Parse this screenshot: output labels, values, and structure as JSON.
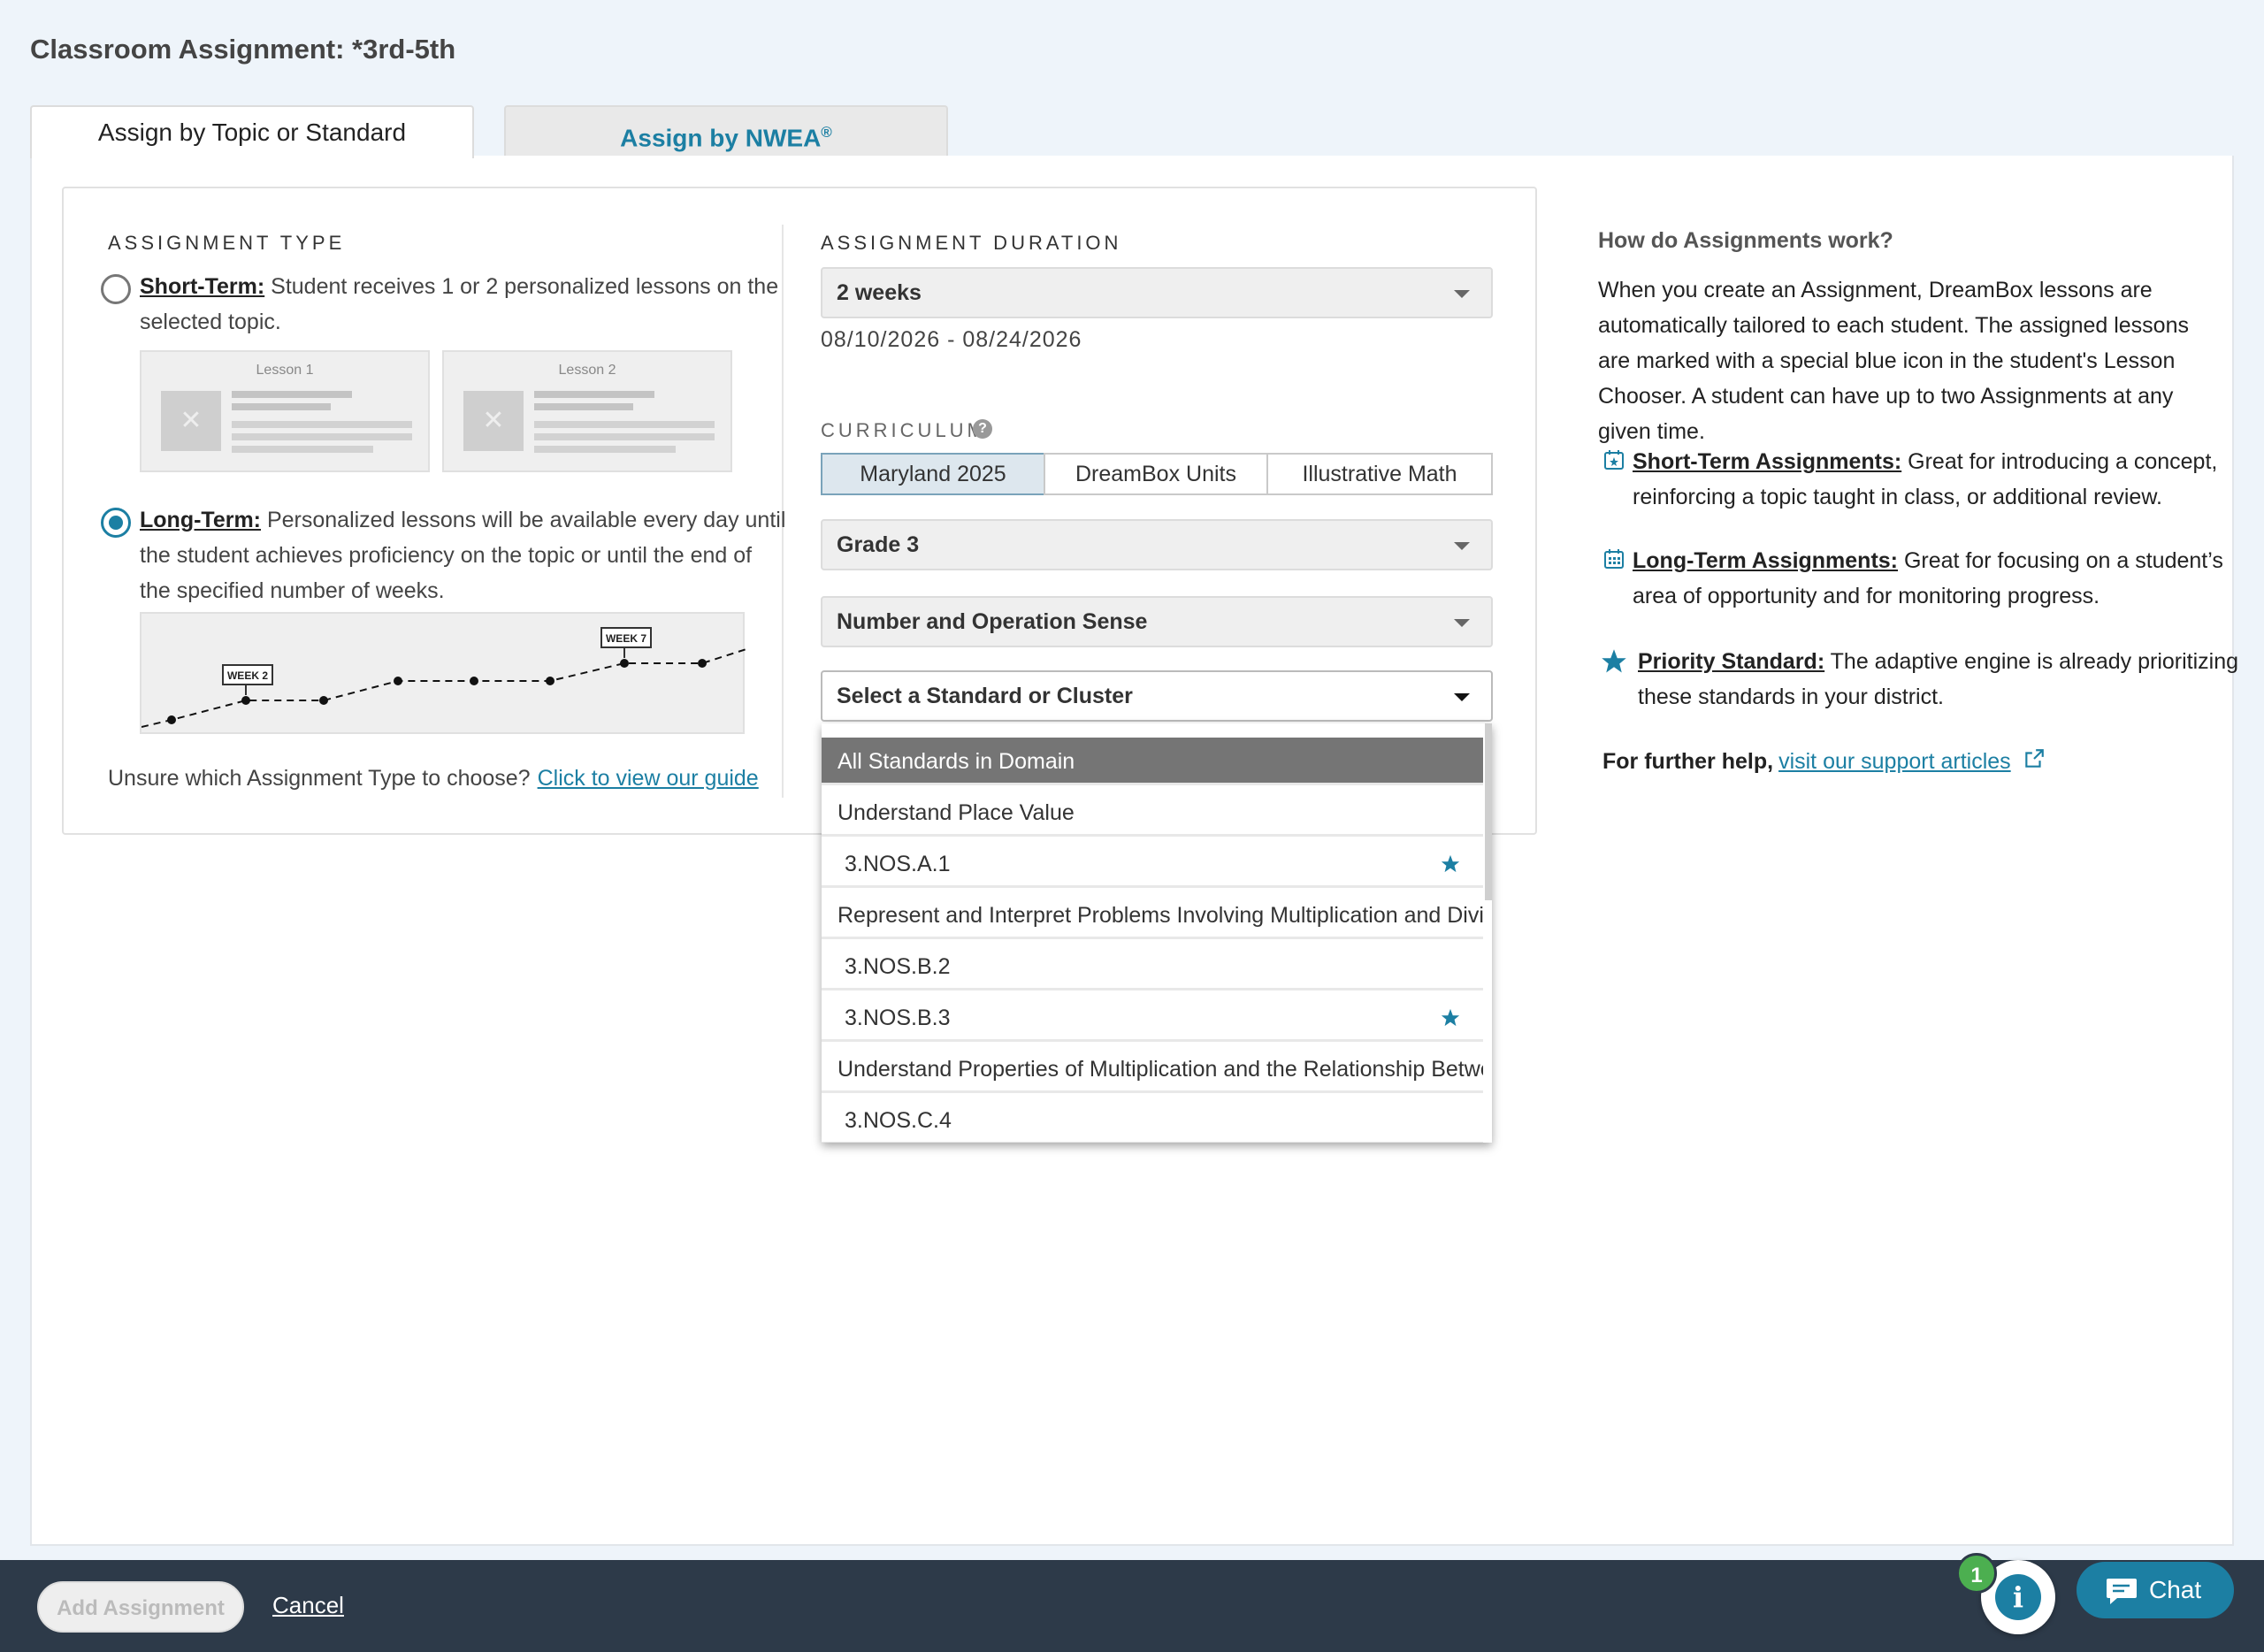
{
  "page": {
    "title": "Classroom Assignment: *3rd-5th"
  },
  "tabs": {
    "topic": "Assign by Topic or Standard",
    "nwea": "Assign by NWEA",
    "nwea_mark": "®"
  },
  "assignment_type": {
    "label": "ASSIGNMENT TYPE",
    "short_term": {
      "label": "Short-Term:",
      "desc_1": " Student receives 1 or 2 personalized lessons on the",
      "desc_2": "selected topic.",
      "checked": false
    },
    "lesson_1": "Lesson 1",
    "lesson_2": "Lesson 2",
    "long_term": {
      "label": "Long-Term:",
      "desc_1": " Personalized lessons will be available every day until",
      "desc_2": "the student achieves proficiency on the topic or until the end of",
      "desc_3": "the specified number of weeks.",
      "checked": true
    },
    "chart_week_a": "WEEK 2",
    "chart_week_b": "WEEK 7",
    "guide_prompt": "Unsure which Assignment Type to choose?",
    "guide_link": "Click to view our guide"
  },
  "duration": {
    "label": "ASSIGNMENT DURATION",
    "value": "2 weeks",
    "date_range": "08/10/2026 - 08/24/2026"
  },
  "curriculum": {
    "label": "CURRICULUM",
    "help_icon": "?",
    "options": [
      "Maryland 2025",
      "DreamBox Units",
      "Illustrative Math"
    ],
    "selected": "Maryland 2025",
    "grade": "Grade 3",
    "domain": "Number and Operation Sense",
    "standard_placeholder": "Select a Standard or Cluster"
  },
  "dropdown": {
    "items": [
      {
        "text": "All Standards in Domain",
        "priority": false
      },
      {
        "text": "Understand Place Value",
        "priority": false
      },
      {
        "text": "3.NOS.A.1",
        "priority": true
      },
      {
        "text": "Represent and Interpret Problems Involving Multiplication and Divis...",
        "priority": false
      },
      {
        "text": "3.NOS.B.2",
        "priority": false
      },
      {
        "text": "3.NOS.B.3",
        "priority": true
      },
      {
        "text": "Understand Properties of Multiplication and the Relationship Betwe...",
        "priority": false
      },
      {
        "text": "3.NOS.C.4",
        "priority": false
      }
    ]
  },
  "info": {
    "title": "How do Assignments work?",
    "para": "When you create an Assignment, DreamBox lessons are automatically tailored to each student. The assigned lessons are marked with a special blue icon in the student's Lesson Chooser. A student can have up to two Assignments at any given time.",
    "short_label": "Short-Term Assignments:",
    "short_desc_1": " Great for introducing a concept,",
    "short_desc_2": "reinforcing a topic taught in class, or additional review.",
    "long_label": "Long-Term Assignments:",
    "long_desc_1": " Great for focusing on a student’s",
    "long_desc_2": "area of opportunity and for monitoring progress.",
    "priority_label": "Priority Standard:",
    "priority_desc_1": " The adaptive engine is already prioritizing",
    "priority_desc_2": "these standards in your district.",
    "help_prefix": "For further help,",
    "help_link": "visit our support articles"
  },
  "footer": {
    "add": "Add Assignment",
    "cancel": "Cancel",
    "badge": "1",
    "info_icon": "i",
    "chat": "Chat"
  },
  "colors": {
    "accent": "#1c7fa3",
    "footer": "#2d3a49",
    "badge": "#4caf50"
  }
}
